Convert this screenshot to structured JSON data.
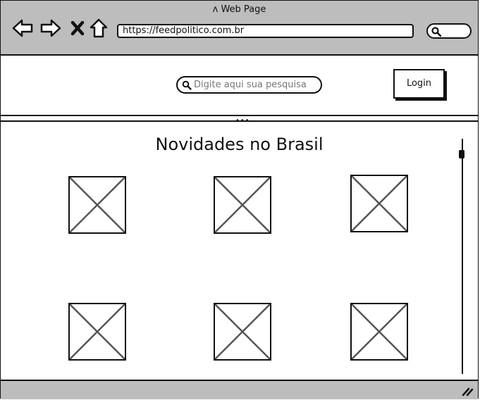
{
  "window": {
    "title": "Web Page"
  },
  "browser": {
    "url": "https://feedpolitico.com.br"
  },
  "header": {
    "search_placeholder": "Digite aqui sua pesquisa",
    "login_label": "Login"
  },
  "main": {
    "title": "Novidades no Brasil",
    "image_count": 6
  },
  "colors": {
    "chrome": "#bdbdbd",
    "border": "#111111",
    "background": "#ffffff"
  }
}
